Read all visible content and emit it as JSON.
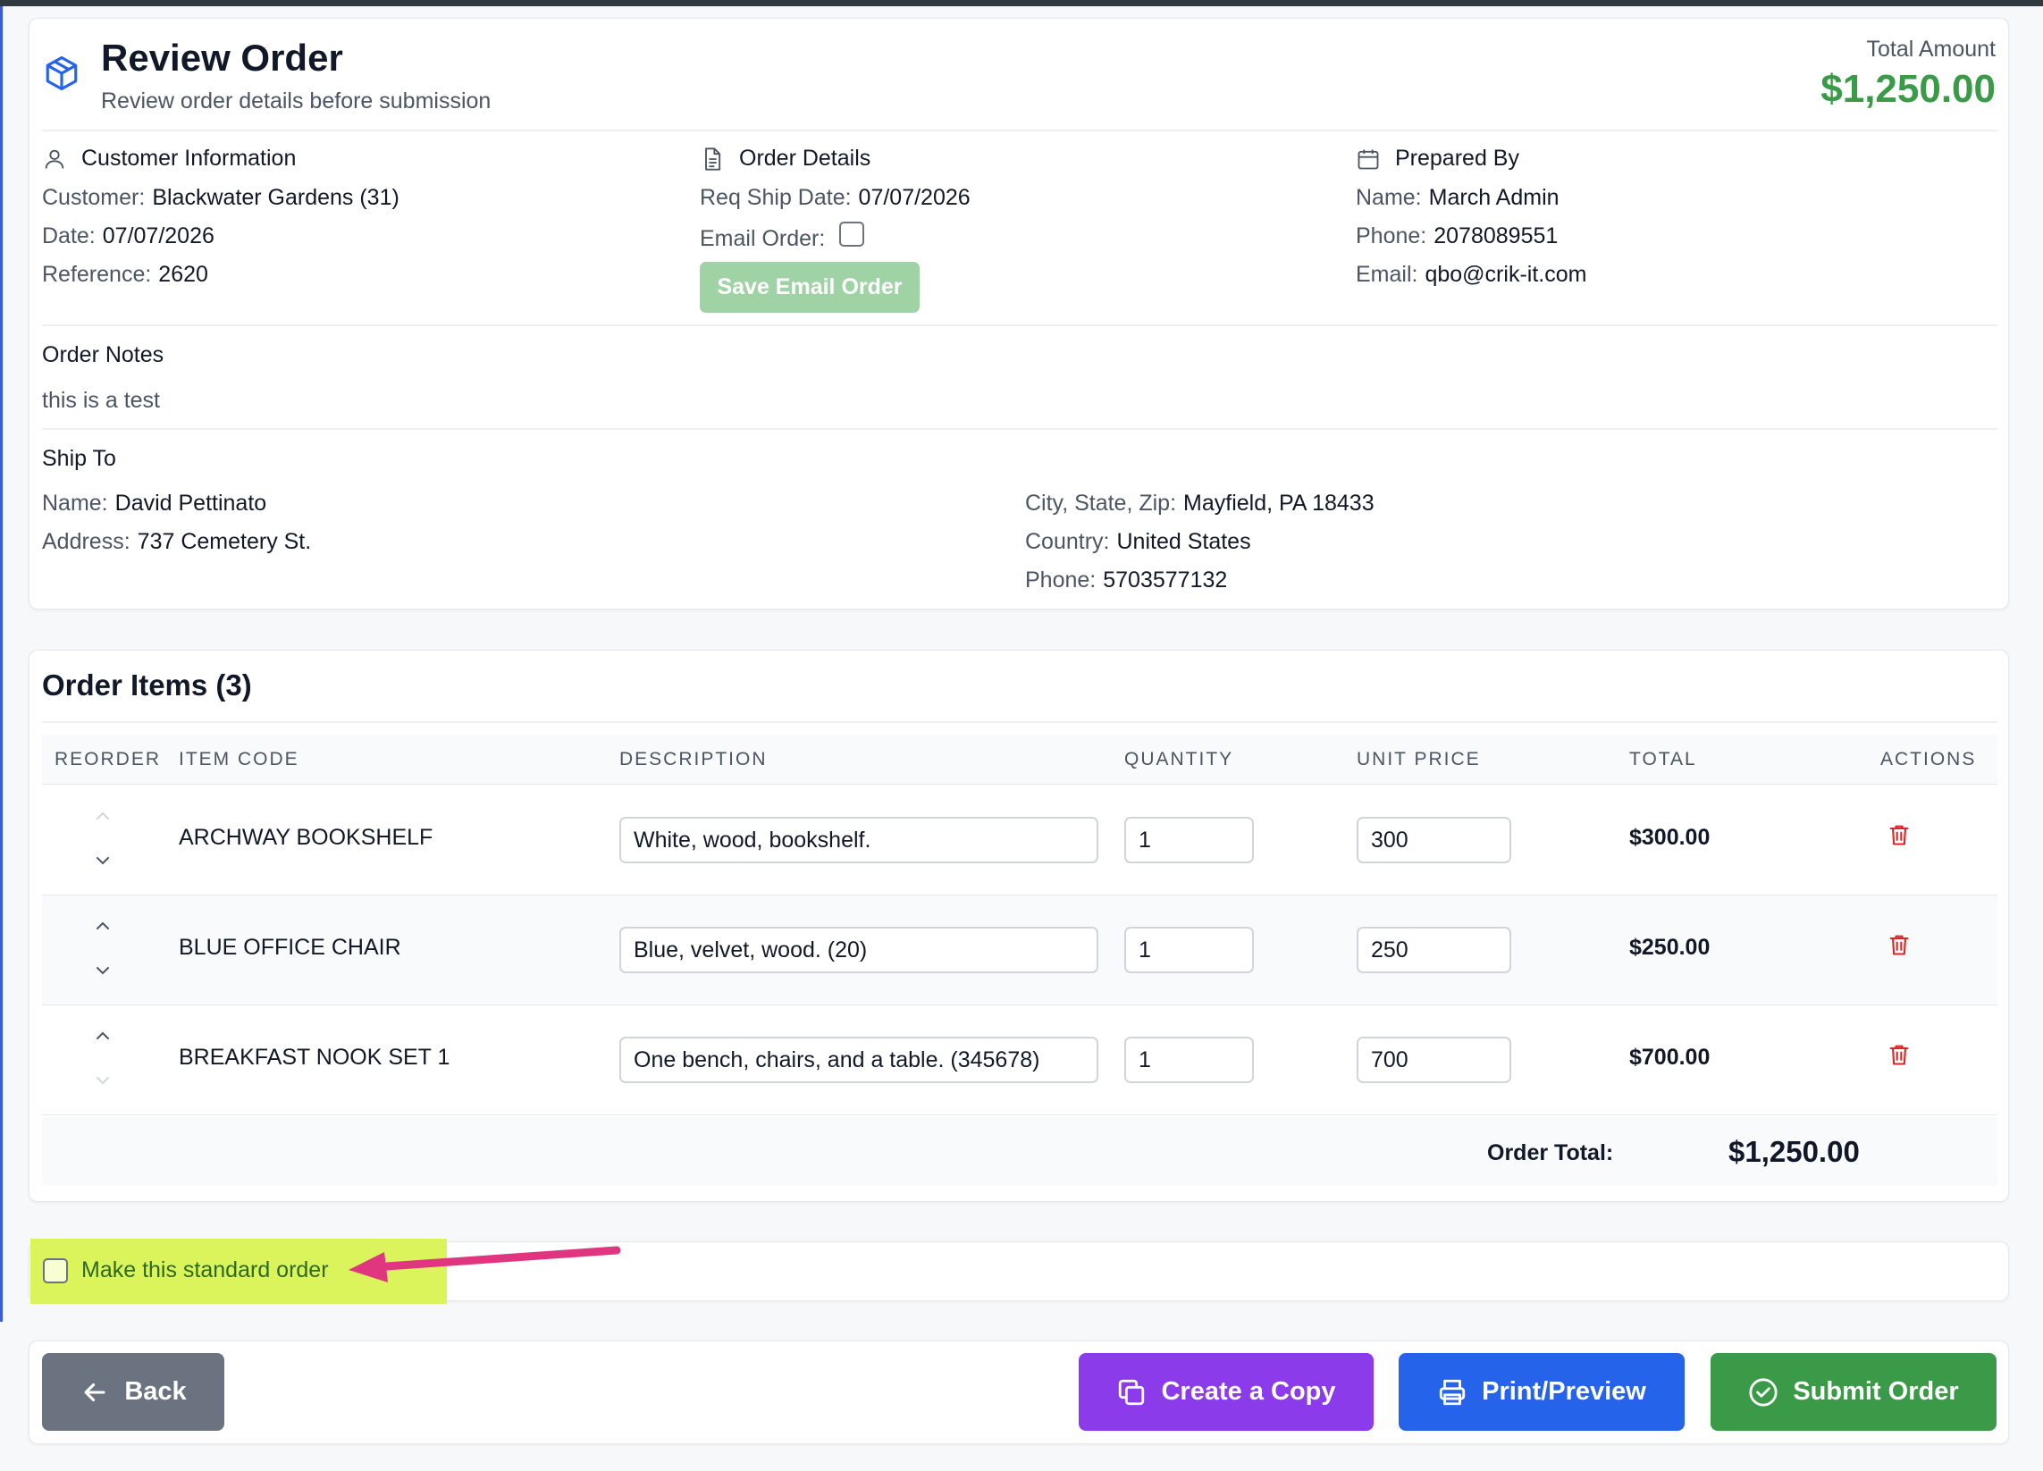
{
  "header": {
    "title": "Review Order",
    "subtitle": "Review order details before submission",
    "total_label": "Total Amount",
    "total_value": "$1,250.00",
    "icon": "box-icon"
  },
  "customer": {
    "heading": "Customer Information",
    "customer_label": "Customer:",
    "customer_value": "Blackwater Gardens (31)",
    "date_label": "Date:",
    "date_value": "07/07/2026",
    "reference_label": "Reference:",
    "reference_value": "2620"
  },
  "order_details": {
    "heading": "Order Details",
    "ship_label": "Req Ship Date:",
    "ship_value": "07/07/2026",
    "email_order_label": "Email Order:",
    "email_order_checked": false,
    "save_button": "Save Email Order"
  },
  "prepared_by": {
    "heading": "Prepared By",
    "name_label": "Name:",
    "name_value": "March Admin",
    "phone_label": "Phone:",
    "phone_value": "2078089551",
    "email_label": "Email:",
    "email_value": "qbo@crik-it.com"
  },
  "notes": {
    "heading": "Order Notes",
    "text": "this is a test"
  },
  "ship_to": {
    "heading": "Ship To",
    "name_label": "Name:",
    "name_value": "David Pettinato",
    "address_label": "Address:",
    "address_value": "737 Cemetery St.",
    "csz_label": "City, State, Zip:",
    "csz_value": "Mayfield, PA 18433",
    "country_label": "Country:",
    "country_value": "United States",
    "phone_label": "Phone:",
    "phone_value": "5703577132"
  },
  "items": {
    "title": "Order Items (3)",
    "columns": [
      "REORDER",
      "ITEM CODE",
      "DESCRIPTION",
      "QUANTITY",
      "UNIT PRICE",
      "TOTAL",
      "ACTIONS"
    ],
    "rows": [
      {
        "code": "ARCHWAY BOOKSHELF",
        "description": "White, wood, bookshelf.",
        "quantity": "1",
        "price": "300",
        "total": "$300.00"
      },
      {
        "code": "BLUE OFFICE CHAIR",
        "description": "Blue, velvet, wood. (20)",
        "quantity": "1",
        "price": "250",
        "total": "$250.00"
      },
      {
        "code": "BREAKFAST NOOK SET 1",
        "description": "One bench, chairs, and a table. (345678)",
        "quantity": "1",
        "price": "700",
        "total": "$700.00"
      }
    ],
    "order_total_label": "Order Total:",
    "order_total_value": "$1,250.00"
  },
  "standard_order": {
    "label": "Make this standard order",
    "checked": false,
    "highlight_color": "#dcf45c",
    "arrow_color": "#e0357f"
  },
  "actions": {
    "back": "Back",
    "copy": "Create a Copy",
    "print": "Print/Preview",
    "submit": "Submit Order"
  },
  "colors": {
    "accent_green": "#3a9a48",
    "purple": "#8b3bea",
    "blue": "#2563eb",
    "gray": "#6b7280",
    "danger": "#dc2626"
  }
}
